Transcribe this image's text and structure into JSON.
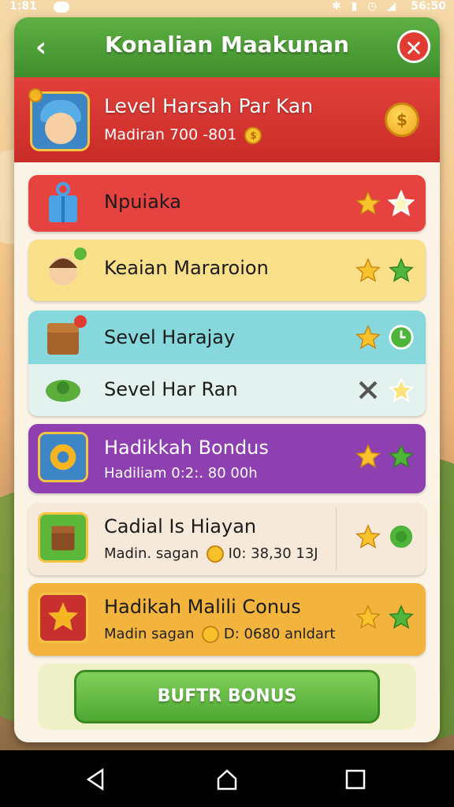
{
  "status_bar": {
    "time": "1:81",
    "icons": "✱ ▮ ◷ ◢",
    "clock": "56:50"
  },
  "title_bar": {
    "back_glyph": "‹",
    "title": "Konalian Maakunan",
    "close_glyph": "✕"
  },
  "header": {
    "title": "Level Harsah Par Kan",
    "subtitle": "Madiran 700 -801",
    "coin_glyph": "$"
  },
  "rows": [
    {
      "label": "Npuiaka",
      "color": "#e6423f",
      "stars": [
        "gold",
        "gold-outline"
      ]
    },
    {
      "label": "Keaian Mararoion",
      "color": "#fbe08a",
      "stars": [
        "gold",
        "green"
      ]
    },
    {
      "label": "Sevel Harajay",
      "color": "#86d8dc",
      "stars": [
        "gold",
        "green-clock"
      ]
    },
    {
      "label": "Sevel Har Ran",
      "color": "#e3f2ef",
      "stars": [
        "cross",
        "gold-outline"
      ]
    },
    {
      "label": "Hadikkah Bondus",
      "sub": "Hadiliam 0:2:. 80 00h",
      "color": "#8e3fb0",
      "stars": [
        "gold",
        "green"
      ]
    },
    {
      "label": "Cadial Is Hiayan",
      "sub": "Madin. sagan",
      "sub_value": "I0: 38,30 13J",
      "color": "#f6e9da",
      "stars": [
        "gold",
        "green"
      ]
    },
    {
      "label": "Hadikah Malili Conus",
      "sub": "Madin sagan",
      "sub_value": "D: 0680 anldart",
      "color": "#f2b43c",
      "stars": [
        "gold",
        "green"
      ]
    }
  ],
  "footer": {
    "button_label": "BUFTR BONUS"
  },
  "icons": {
    "back": "chevron-left-icon",
    "close": "close-icon",
    "coin": "coin-icon",
    "star": "star-icon",
    "nav_back": "triangle-back-icon",
    "nav_home": "home-icon",
    "nav_recents": "square-recents-icon"
  },
  "colors": {
    "title_bar": "#4a9e35",
    "header": "#d63430",
    "button": "#5cb83a",
    "panel": "#fbf3e6"
  }
}
